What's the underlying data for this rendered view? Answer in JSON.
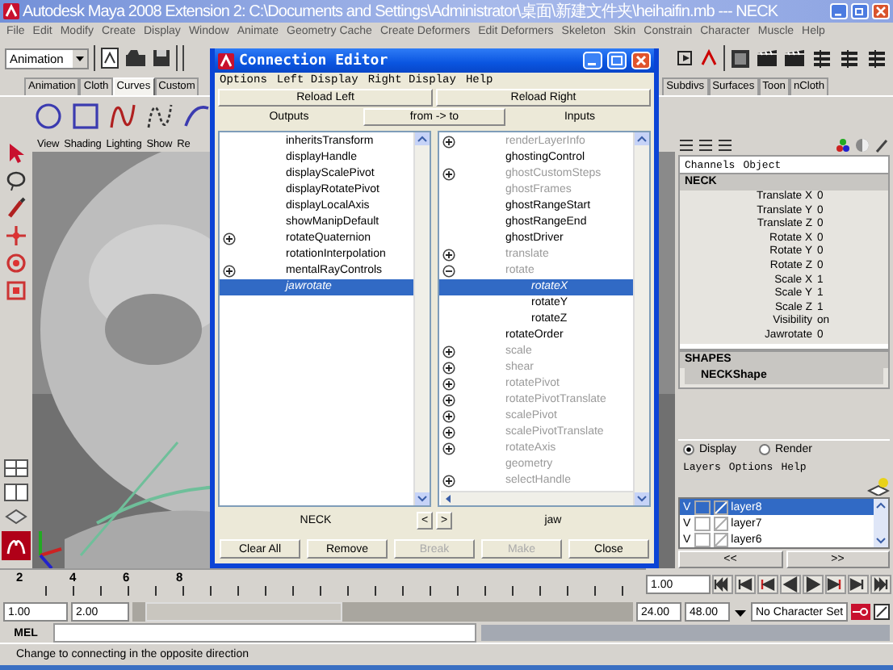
{
  "window": {
    "title": "Autodesk Maya 2008 Extension 2: C:\\Documents and Settings\\Administrator\\桌面\\新建文件夹\\heihaifin.mb --- NECK"
  },
  "menu_bar": [
    "File",
    "Edit",
    "Modify",
    "Create",
    "Display",
    "Window",
    "Animate",
    "Geometry Cache",
    "Create Deformers",
    "Edit Deformers",
    "Skeleton",
    "Skin",
    "Constrain",
    "Character",
    "Muscle",
    "Help"
  ],
  "toolbar": {
    "menu_set": "Animation"
  },
  "shelf": {
    "tabs": [
      {
        "label": "Animation",
        "selected": false
      },
      {
        "label": "Cloth",
        "selected": false
      },
      {
        "label": "Curves",
        "selected": true
      },
      {
        "label": "Custom",
        "selected": false
      },
      {
        "label": "Subdivs",
        "selected": false
      },
      {
        "label": "Surfaces",
        "selected": false
      },
      {
        "label": "Toon",
        "selected": false
      },
      {
        "label": "nCloth",
        "selected": false
      }
    ]
  },
  "viewport": {
    "menu": [
      "View",
      "Shading",
      "Lighting",
      "Show",
      "Re"
    ]
  },
  "channel_box": {
    "menu": [
      "Channels",
      "Object"
    ],
    "object": "NECK",
    "channels": [
      {
        "name": "Translate X",
        "value": "0"
      },
      {
        "name": "Translate Y",
        "value": "0"
      },
      {
        "name": "Translate Z",
        "value": "0"
      },
      {
        "name": "Rotate X",
        "value": "0"
      },
      {
        "name": "Rotate Y",
        "value": "0"
      },
      {
        "name": "Rotate Z",
        "value": "0"
      },
      {
        "name": "Scale X",
        "value": "1"
      },
      {
        "name": "Scale Y",
        "value": "1"
      },
      {
        "name": "Scale Z",
        "value": "1"
      },
      {
        "name": "Visibility",
        "value": "on"
      },
      {
        "name": "Jawrotate",
        "value": "0"
      }
    ],
    "shapes_title": "SHAPES",
    "shape": "NECKShape"
  },
  "layer_editor": {
    "modes": [
      {
        "label": "Display",
        "selected": true
      },
      {
        "label": "Render",
        "selected": false
      }
    ],
    "menu": [
      "Layers",
      "Options",
      "Help"
    ],
    "layers": [
      {
        "name": "layer8",
        "visibility": "V",
        "selected": true
      },
      {
        "name": "layer7",
        "visibility": "V",
        "selected": false
      },
      {
        "name": "layer6",
        "visibility": "V",
        "selected": false
      }
    ],
    "nav": [
      "<<",
      ">>"
    ]
  },
  "time_slider": {
    "ticks": [
      "2",
      "4",
      "6",
      "8"
    ],
    "current_time": "1.00"
  },
  "range_slider": {
    "start_time": "1.00",
    "playback_start": "2.00",
    "playback_end": "24.00",
    "end_time": "48.00",
    "character_set": "No Character Set"
  },
  "command_line": {
    "language": "MEL"
  },
  "help_line": "Change to connecting in the opposite direction",
  "connection_editor": {
    "title": "Connection Editor",
    "menu": [
      "Options",
      "Left Display",
      "Right Display",
      "Help"
    ],
    "reload_buttons": [
      "Reload Left",
      "Reload Right"
    ],
    "direction": {
      "outputs": "Outputs",
      "swap": "from -> to",
      "inputs": "Inputs"
    },
    "left_list": [
      {
        "label": "inheritsTransform",
        "kind": "leaf",
        "dim": false,
        "selected": false
      },
      {
        "label": "displayHandle",
        "kind": "leaf",
        "dim": false,
        "selected": false
      },
      {
        "label": "displayScalePivot",
        "kind": "leaf",
        "dim": false,
        "selected": false
      },
      {
        "label": "displayRotatePivot",
        "kind": "leaf",
        "dim": false,
        "selected": false
      },
      {
        "label": "displayLocalAxis",
        "kind": "leaf",
        "dim": false,
        "selected": false
      },
      {
        "label": "showManipDefault",
        "kind": "leaf",
        "dim": false,
        "selected": false
      },
      {
        "label": "rotateQuaternion",
        "kind": "group",
        "expanded": false,
        "dim": false,
        "selected": false
      },
      {
        "label": "rotationInterpolation",
        "kind": "leaf",
        "dim": false,
        "selected": false
      },
      {
        "label": "mentalRayControls",
        "kind": "group",
        "expanded": false,
        "dim": false,
        "selected": false
      },
      {
        "label": "jawrotate",
        "kind": "leaf",
        "dim": false,
        "selected": true
      }
    ],
    "right_list": [
      {
        "label": "renderLayerInfo",
        "kind": "group",
        "expanded": false,
        "dim": true,
        "selected": false
      },
      {
        "label": "ghostingControl",
        "kind": "leaf",
        "dim": false,
        "selected": false
      },
      {
        "label": "ghostCustomSteps",
        "kind": "group",
        "expanded": false,
        "dim": true,
        "selected": false
      },
      {
        "label": "ghostFrames",
        "kind": "leaf",
        "dim": true,
        "selected": false
      },
      {
        "label": "ghostRangeStart",
        "kind": "leaf",
        "dim": false,
        "selected": false
      },
      {
        "label": "ghostRangeEnd",
        "kind": "leaf",
        "dim": false,
        "selected": false
      },
      {
        "label": "ghostDriver",
        "kind": "leaf",
        "dim": false,
        "selected": false
      },
      {
        "label": "translate",
        "kind": "group",
        "expanded": false,
        "dim": true,
        "selected": false
      },
      {
        "label": "rotate",
        "kind": "group",
        "expanded": true,
        "dim": true,
        "selected": false,
        "children": [
          {
            "label": "rotateX",
            "kind": "leaf",
            "dim": false,
            "selected": true
          },
          {
            "label": "rotateY",
            "kind": "leaf",
            "dim": false,
            "selected": false
          },
          {
            "label": "rotateZ",
            "kind": "leaf",
            "dim": false,
            "selected": false
          }
        ]
      },
      {
        "label": "rotateOrder",
        "kind": "leaf",
        "dim": false,
        "selected": false
      },
      {
        "label": "scale",
        "kind": "group",
        "expanded": false,
        "dim": true,
        "selected": false
      },
      {
        "label": "shear",
        "kind": "group",
        "expanded": false,
        "dim": true,
        "selected": false
      },
      {
        "label": "rotatePivot",
        "kind": "group",
        "expanded": false,
        "dim": true,
        "selected": false
      },
      {
        "label": "rotatePivotTranslate",
        "kind": "group",
        "expanded": false,
        "dim": true,
        "selected": false
      },
      {
        "label": "scalePivot",
        "kind": "group",
        "expanded": false,
        "dim": true,
        "selected": false
      },
      {
        "label": "scalePivotTranslate",
        "kind": "group",
        "expanded": false,
        "dim": true,
        "selected": false
      },
      {
        "label": "rotateAxis",
        "kind": "group",
        "expanded": false,
        "dim": true,
        "selected": false
      },
      {
        "label": "geometry",
        "kind": "leaf",
        "dim": true,
        "selected": false
      },
      {
        "label": "selectHandle",
        "kind": "group",
        "expanded": false,
        "dim": true,
        "selected": false
      }
    ],
    "left_node": "NECK",
    "right_node": "jaw",
    "arrows": [
      "<",
      ">"
    ],
    "buttons": [
      {
        "label": "Clear All",
        "disabled": false
      },
      {
        "label": "Remove",
        "disabled": false
      },
      {
        "label": "Break",
        "disabled": true
      },
      {
        "label": "Make",
        "disabled": true
      },
      {
        "label": "Close",
        "disabled": false
      }
    ]
  }
}
